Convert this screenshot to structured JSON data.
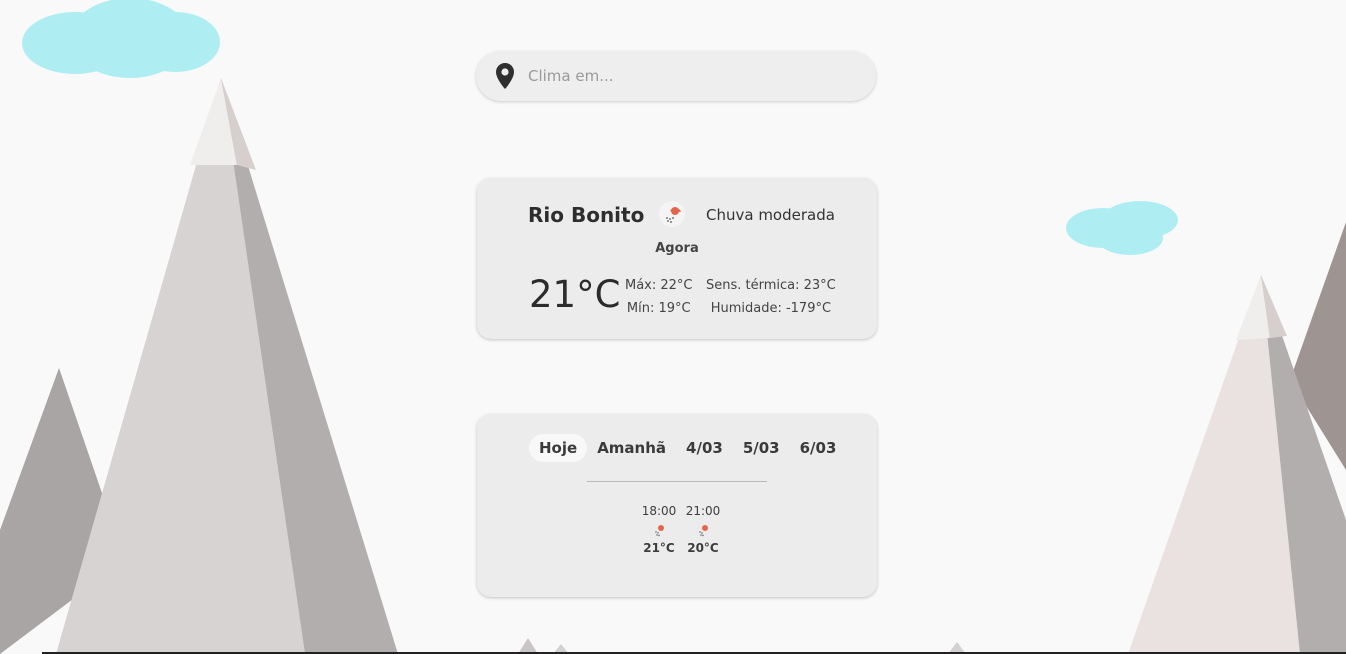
{
  "search": {
    "placeholder": "Clima em..."
  },
  "current": {
    "city": "Rio Bonito",
    "condition": "Chuva moderada",
    "condition_icon": "rain-sun-icon",
    "time_label": "Agora",
    "temperature": "21°C",
    "max": "Máx: 22°C",
    "min": "Mín: 19°C",
    "feels_like": "Sens. térmica: 23°C",
    "humidity": "Humidade: -179°C"
  },
  "forecast": {
    "tabs": [
      "Hoje",
      "Amanhã",
      "4/03",
      "5/03",
      "6/03"
    ],
    "active_tab": "Hoje",
    "hours": [
      {
        "time": "18:00",
        "icon": "rain-sun-icon",
        "temp": "21°C"
      },
      {
        "time": "21:00",
        "icon": "rain-sun-icon",
        "temp": "20°C"
      }
    ]
  },
  "colors": {
    "background": "#f9f9f9",
    "card": "#ececec",
    "cloud": "#aeeef3",
    "icon_accent": "#e4664a"
  }
}
